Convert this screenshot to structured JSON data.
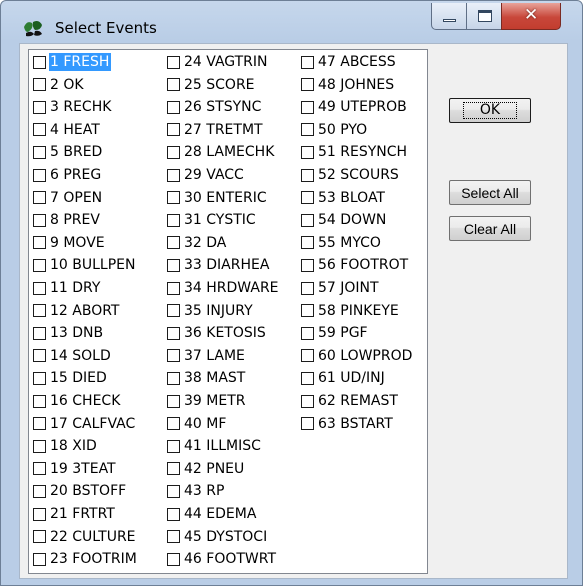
{
  "window": {
    "title": "Select Events"
  },
  "buttons": {
    "ok": "OK",
    "select_all": "Select All",
    "clear_all": "Clear All"
  },
  "events": {
    "columns": [
      [
        "1 FRESH",
        "2 OK",
        "3 RECHK",
        "4 HEAT",
        "5 BRED",
        "6 PREG",
        "7 OPEN",
        "8 PREV",
        "9 MOVE",
        "10 BULLPEN",
        "11 DRY",
        "12 ABORT",
        "13 DNB",
        "14 SOLD",
        "15 DIED",
        "16 CHECK",
        "17 CALFVAC",
        "18 XID",
        "19 3TEAT",
        "20 BSTOFF",
        "21 FRTRT",
        "22 CULTURE",
        "23 FOOTRIM"
      ],
      [
        "24 VAGTRIN",
        "25 SCORE",
        "26 STSYNC",
        "27 TRETMT",
        "28 LAMECHK",
        "29 VACC",
        "30 ENTERIC",
        "31 CYSTIC",
        "32 DA",
        "33 DIARHEA",
        "34 HRDWARE",
        "35 INJURY",
        "36 KETOSIS",
        "37 LAME",
        "38 MAST",
        "39 METR",
        "40 MF",
        "41 ILLMISC",
        "42 PNEU",
        "43 RP",
        "44 EDEMA",
        "45 DYSTOCI",
        "46 FOOTWRT"
      ],
      [
        "47 ABCESS",
        "48 JOHNES",
        "49 UTEPROB",
        "50 PYO",
        "51 RESYNCH",
        "52 SCOURS",
        "53 BLOAT",
        "54 DOWN",
        "55 MYCO",
        "56 FOOTROT",
        "57 JOINT",
        "58 PINKEYE",
        "59 PGF",
        "60 LOWPROD",
        "61 UD/INJ",
        "62 REMAST",
        "63 BSTART"
      ]
    ],
    "selected": "1 FRESH"
  }
}
